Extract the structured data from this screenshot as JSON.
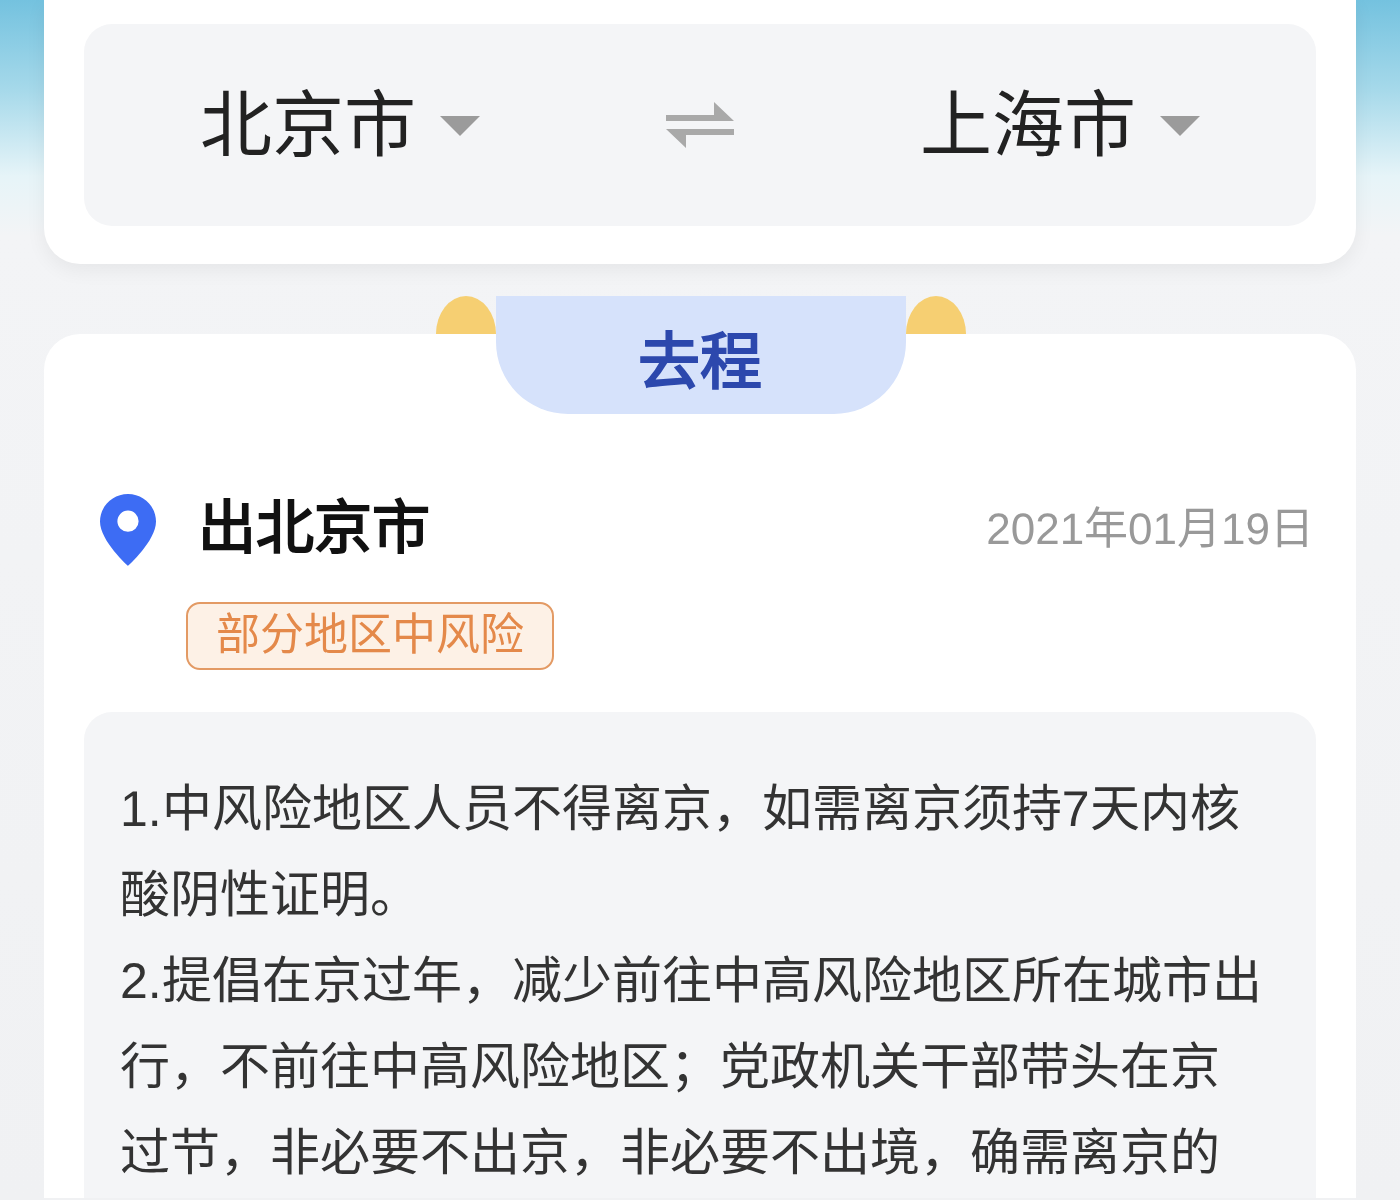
{
  "route": {
    "from_city": "北京市",
    "to_city": "上海市"
  },
  "direction_tab": {
    "label": "去程"
  },
  "departure": {
    "title": "出北京市",
    "date": "2021年01月19日",
    "risk_badge": "部分地区中风险",
    "notices": [
      "1.中风险地区人员不得离京，如需离京须持7天内核酸阴性证明。",
      "2.提倡在京过年，减少前往中高风险地区所在城市出行，不前往中高风险地区；党政机关干部带头在京过节，非必要不出京，非必要不出境，确需离京的"
    ]
  }
}
